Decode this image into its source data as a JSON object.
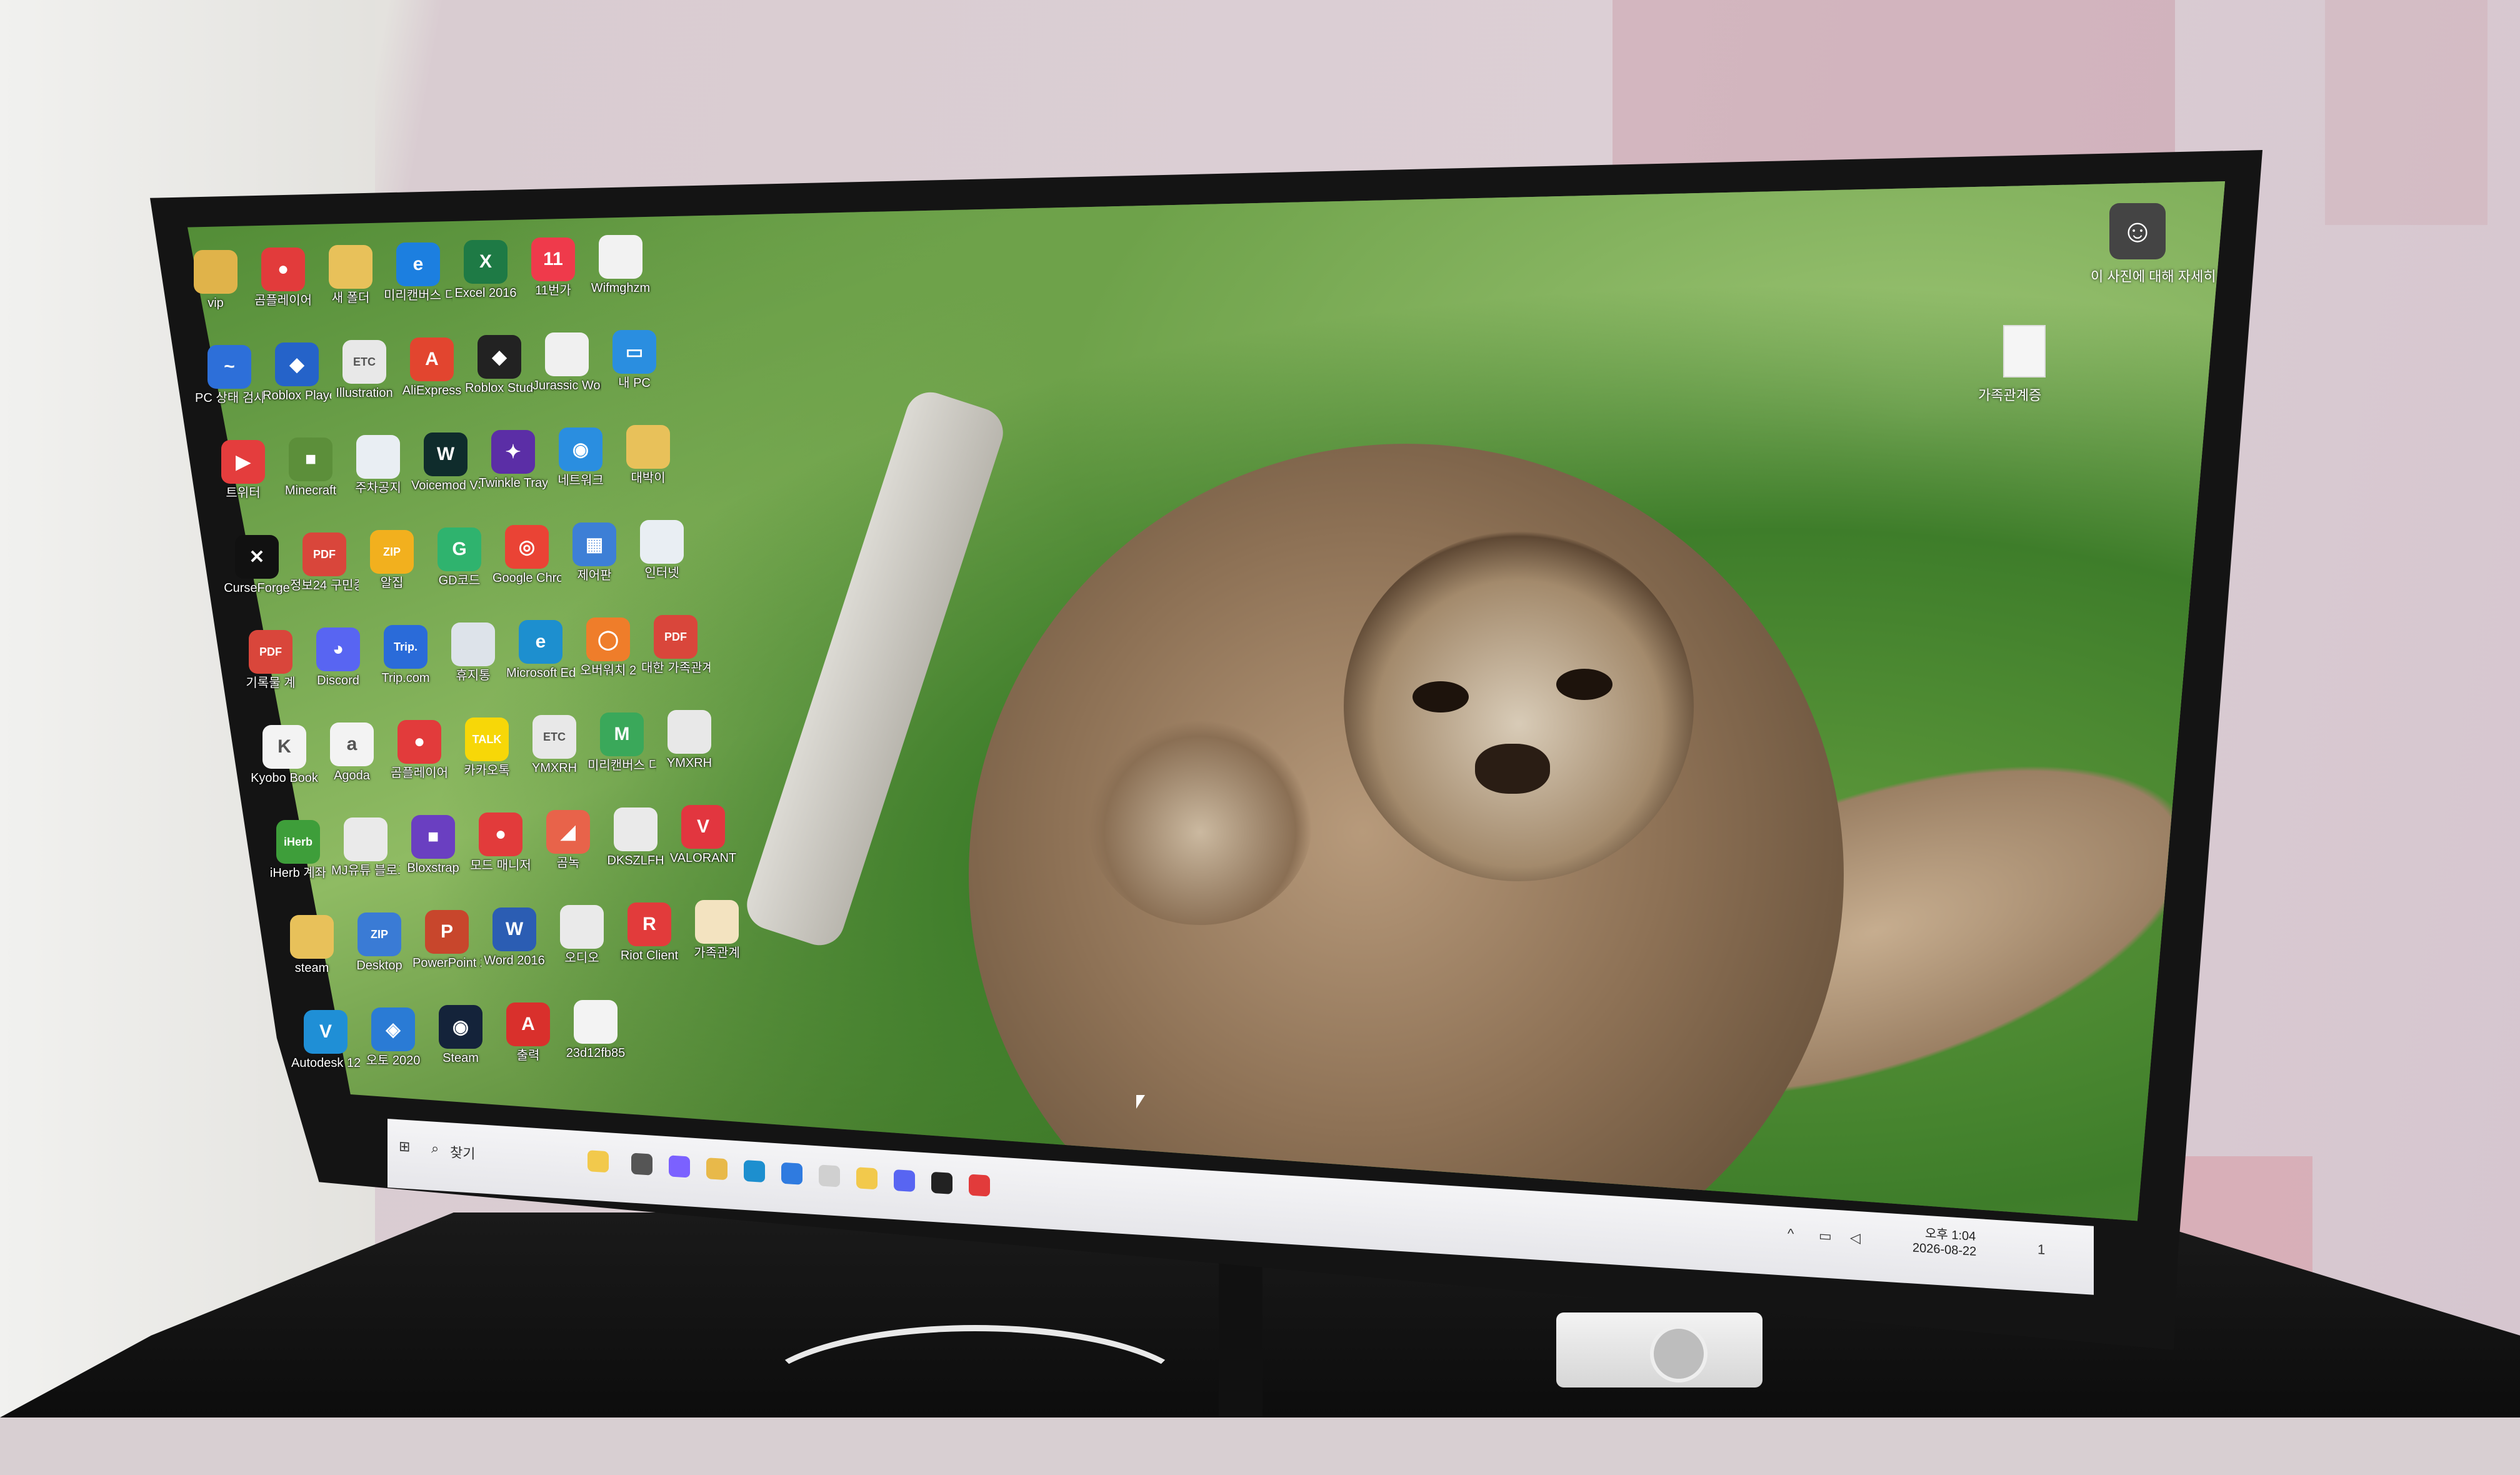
{
  "desktop_icons": [
    {
      "label": "vip",
      "color": "#e0b34a",
      "glyph": ""
    },
    {
      "label": "곰플레이어",
      "color": "#e23b3b",
      "glyph": "●"
    },
    {
      "label": "새 폴더",
      "color": "#e8c15a",
      "glyph": ""
    },
    {
      "label": "미리캔버스 디자인",
      "color": "#1c7fe0",
      "glyph": "e"
    },
    {
      "label": "Excel 2016",
      "color": "#1e7a45",
      "glyph": "X"
    },
    {
      "label": "11번가",
      "color": "#ef3a4b",
      "glyph": "11"
    },
    {
      "label": "Wifmghzm",
      "color": "#f2f2f2",
      "glyph": ""
    },
    {
      "label": "PC 상태 검사",
      "color": "#2d6fd9",
      "glyph": "~"
    },
    {
      "label": "Roblox Player",
      "color": "#2563c9",
      "glyph": "◆"
    },
    {
      "label": "Illustration",
      "color": "#e8e8e8",
      "glyph": "ETC"
    },
    {
      "label": "AliExpress",
      "color": "#e2452f",
      "glyph": "A"
    },
    {
      "label": "Roblox Studio",
      "color": "#222222",
      "glyph": "◆"
    },
    {
      "label": "Jurassic World",
      "color": "#f0f0f0",
      "glyph": ""
    },
    {
      "label": "내 PC",
      "color": "#2a8ee0",
      "glyph": "▭"
    },
    {
      "label": "트위터",
      "color": "#e43d3d",
      "glyph": "▶"
    },
    {
      "label": "Minecraft",
      "color": "#5c8f3a",
      "glyph": "■"
    },
    {
      "label": "주차공지",
      "color": "#e9eef3",
      "glyph": ""
    },
    {
      "label": "Voicemod V3",
      "color": "#0f2c2c",
      "glyph": "W"
    },
    {
      "label": "Twinkle Tray",
      "color": "#5b2ea6",
      "glyph": "✦"
    },
    {
      "label": "네트워크",
      "color": "#2a8ee0",
      "glyph": "◉"
    },
    {
      "label": "대박이",
      "color": "#e8c15a",
      "glyph": ""
    },
    {
      "label": "CurseForge",
      "color": "#111111",
      "glyph": "✕"
    },
    {
      "label": "정보24 구민증",
      "color": "#d9463b",
      "glyph": "PDF"
    },
    {
      "label": "알집",
      "color": "#f2b01e",
      "glyph": "ZIP"
    },
    {
      "label": "GD코드",
      "color": "#2fb36e",
      "glyph": "G"
    },
    {
      "label": "Google Chrome",
      "color": "#ea4335",
      "glyph": "◎"
    },
    {
      "label": "제어판",
      "color": "#3d7fd6",
      "glyph": "▦"
    },
    {
      "label": "인터넷",
      "color": "#e9eef3",
      "glyph": ""
    },
    {
      "label": "기록물 계",
      "color": "#d9463b",
      "glyph": "PDF"
    },
    {
      "label": "Discord",
      "color": "#5865f2",
      "glyph": "◕"
    },
    {
      "label": "Trip.com",
      "color": "#2a6bd9",
      "glyph": "Trip."
    },
    {
      "label": "휴지통",
      "color": "#dde3ea",
      "glyph": ""
    },
    {
      "label": "Microsoft Edge",
      "color": "#1d8fcf",
      "glyph": "e"
    },
    {
      "label": "오버워치 2",
      "color": "#ef7d2a",
      "glyph": "◯"
    },
    {
      "label": "대한 가족관계증",
      "color": "#d9463b",
      "glyph": "PDF"
    },
    {
      "label": "Kyobo Book",
      "color": "#f3f3f3",
      "glyph": "K"
    },
    {
      "label": "Agoda",
      "color": "#f3f3f3",
      "glyph": "a"
    },
    {
      "label": "곰플레이어",
      "color": "#e23b3b",
      "glyph": "●"
    },
    {
      "label": "카카오톡",
      "color": "#f7d708",
      "glyph": "TALK"
    },
    {
      "label": "YMXRH",
      "color": "#e8e8e8",
      "glyph": "ETC"
    },
    {
      "label": "미리캔버스 디자인 만",
      "color": "#3aa85a",
      "glyph": "M"
    },
    {
      "label": "YMXRH",
      "color": "#e8e8e8",
      "glyph": ""
    },
    {
      "label": "iHerb 계좌",
      "color": "#3e9e3a",
      "glyph": "iHerb"
    },
    {
      "label": "MJ유튜 블로그",
      "color": "#eaeaea",
      "glyph": ""
    },
    {
      "label": "Bloxstrap",
      "color": "#6a3fc1",
      "glyph": "■"
    },
    {
      "label": "모드 매니저",
      "color": "#e23b3b",
      "glyph": "●"
    },
    {
      "label": "곰녹",
      "color": "#e8634a",
      "glyph": "◢"
    },
    {
      "label": "DKSZLFH",
      "color": "#eaeaea",
      "glyph": ""
    },
    {
      "label": "VALORANT",
      "color": "#e2363f",
      "glyph": "V"
    },
    {
      "label": "steam",
      "color": "#e8c15a",
      "glyph": ""
    },
    {
      "label": "Desktop",
      "color": "#3a7bd5",
      "glyph": "ZIP"
    },
    {
      "label": "PowerPoint 2016",
      "color": "#c8462c",
      "glyph": "P"
    },
    {
      "label": "Word 2016",
      "color": "#2b5db3",
      "glyph": "W"
    },
    {
      "label": "오디오",
      "color": "#eaeaea",
      "glyph": ""
    },
    {
      "label": "Riot Client",
      "color": "#e23b3b",
      "glyph": "R"
    },
    {
      "label": "가족관계",
      "color": "#f3e3c0",
      "glyph": ""
    },
    {
      "label": "Autodesk 123",
      "color": "#1f8fd6",
      "glyph": "V"
    },
    {
      "label": "오토 2020",
      "color": "#2a7bd5",
      "glyph": "◈"
    },
    {
      "label": "Steam",
      "color": "#14233a",
      "glyph": "◉"
    },
    {
      "label": "출력",
      "color": "#d9302c",
      "glyph": "A"
    },
    {
      "label": "23d12fb85",
      "color": "#f3f3f3",
      "glyph": ""
    }
  ],
  "right_icons": {
    "feedback_label": "이 사진에 대해 자세히",
    "doc_label": "가족관계증"
  },
  "taskbar": {
    "search_label": "찾기",
    "clock_time": "오후 1:04",
    "clock_date": "2026-08-22",
    "notification_count": "1"
  },
  "colors": {
    "taskbar_bg": "#f0f0f3",
    "bezel": "#141414"
  }
}
